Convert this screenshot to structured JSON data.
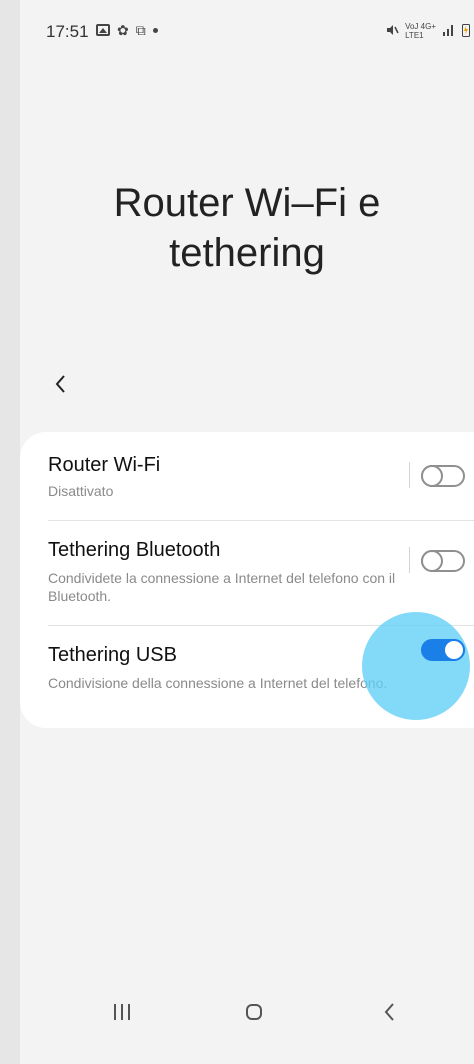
{
  "status_bar": {
    "time": "17:51",
    "net_top": "VoJ 4G+",
    "net_bottom": "LTE1",
    "left_icons": [
      "image-icon",
      "gear-icon",
      "screenshot-icon",
      "dot-icon"
    ],
    "right_icons": [
      "mute-icon",
      "signal-icon",
      "battery-icon"
    ]
  },
  "page": {
    "title_line1": "Router Wi–Fi e",
    "title_line2": "tethering"
  },
  "settings": [
    {
      "title": "Router Wi-Fi",
      "subtitle": "Disattivato",
      "enabled": false
    },
    {
      "title": "Tethering Bluetooth",
      "subtitle": "Condividete la connessione a Internet del telefono con il Bluetooth.",
      "enabled": false
    },
    {
      "title": "Tethering USB",
      "subtitle": "Condivisione della connessione a Internet del telefono.",
      "enabled": true
    }
  ],
  "nav_bar": {
    "icons": [
      "recent-apps-icon",
      "home-icon",
      "back-icon"
    ]
  },
  "colors": {
    "accent": "#1a7fe6",
    "touch_highlight": "#60cef6",
    "background": "#f3f3f3",
    "card": "#ffffff"
  }
}
